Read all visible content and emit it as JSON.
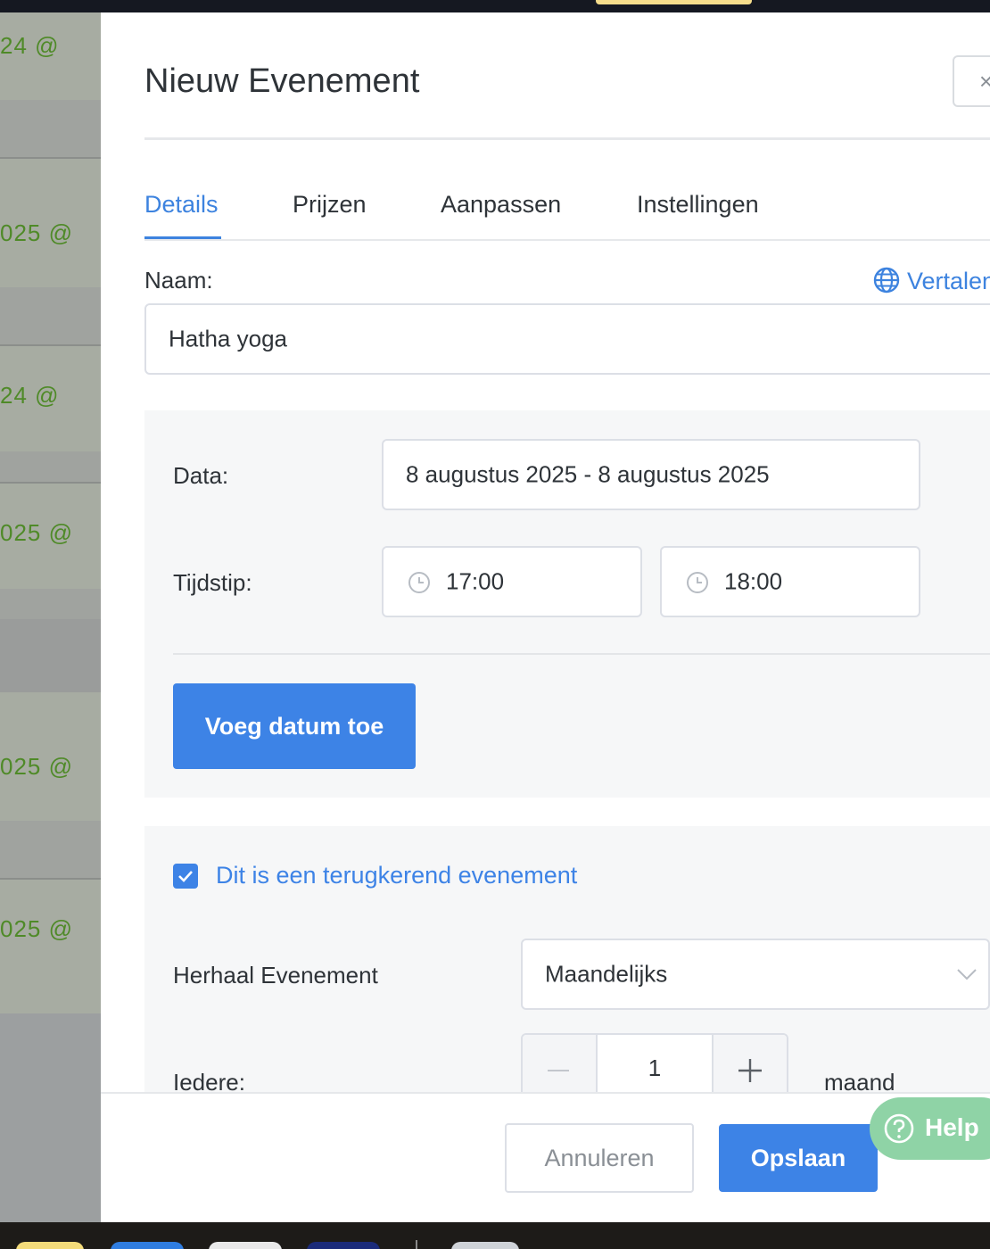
{
  "background_list": {
    "items": [
      "24 @",
      "025 @",
      "24 @",
      "025 @",
      "025 @",
      "025 @"
    ]
  },
  "modal": {
    "title": "Nieuw Evenement",
    "close_icon": "close-icon"
  },
  "tabs": [
    {
      "label": "Details",
      "active": true
    },
    {
      "label": "Prijzen",
      "active": false
    },
    {
      "label": "Aanpassen",
      "active": false
    },
    {
      "label": "Instellingen",
      "active": false
    }
  ],
  "name_field": {
    "label": "Naam:",
    "translate_label": "Vertalen",
    "translate_icon": "globe-icon",
    "value": "Hatha yoga"
  },
  "dates_panel": {
    "dates_label": "Data:",
    "dates_value": "8 augustus 2025 - 8 augustus 2025",
    "time_label": "Tijdstip:",
    "start_time": "17:00",
    "end_time": "18:00",
    "time_icon": "clock-icon",
    "add_date_button": "Voeg datum toe"
  },
  "recurring_panel": {
    "checkbox_label": "Dit is een terugkerend evenement",
    "checked": true,
    "repeat_label": "Herhaal Evenement",
    "repeat_value": "Maandelijks",
    "every_label": "Iedere:",
    "every_value": "1",
    "every_unit": "maand"
  },
  "footer": {
    "cancel_button": "Annuleren",
    "save_button": "Opslaan"
  },
  "help_widget": {
    "label": "Help",
    "icon": "question-circle-icon"
  },
  "colors": {
    "primary": "#3d83e6",
    "text": "#2e3338",
    "background_link": "#4f8a28",
    "help": "#8fd3a6"
  }
}
